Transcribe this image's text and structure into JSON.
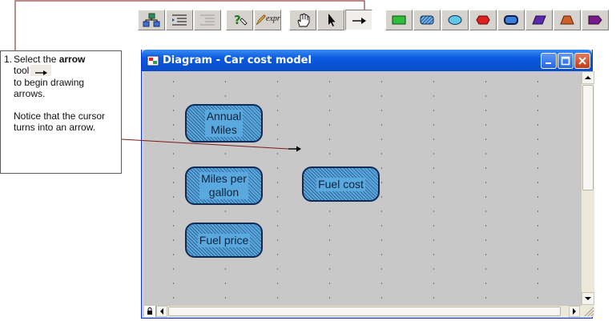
{
  "window": {
    "title": "Diagram - Car cost model"
  },
  "callout": {
    "number": "1.",
    "line1_prefix": "Select the ",
    "line1_bold": "arrow",
    "line2": "tool",
    "line3": "to begin drawing arrows.",
    "line4": "Notice that the cursor turns into an arrow."
  },
  "nodes": [
    {
      "id": "annual-miles",
      "label": "Annual\nMiles"
    },
    {
      "id": "miles-per-gallon",
      "label": "Miles per\ngallon"
    },
    {
      "id": "fuel-cost",
      "label": "Fuel cost"
    },
    {
      "id": "fuel-price",
      "label": "Fuel price"
    }
  ],
  "toolbar": {
    "expression_label": "expr",
    "active_tool": "arrow-tool",
    "icons": [
      "hierarchy-icon",
      "outline-indent-icon",
      "outline-outdent-icon",
      "help-question-icon",
      "expression-pencil-icon",
      "hand-browse-icon",
      "pointer-arrow-icon",
      "arrow-draw-icon",
      "decision-node-icon",
      "chance-node-icon",
      "general-node-icon",
      "objective-node-icon",
      "module-node-icon",
      "index-node-icon",
      "constant-node-icon",
      "alias-node-icon"
    ]
  },
  "colors": {
    "node_fill": "#5aa9de",
    "node_border": "#0d2a55",
    "canvas": "#c8c8c8",
    "title_bar": "#0a5ae0",
    "leader_line": "#7a1a1a"
  }
}
